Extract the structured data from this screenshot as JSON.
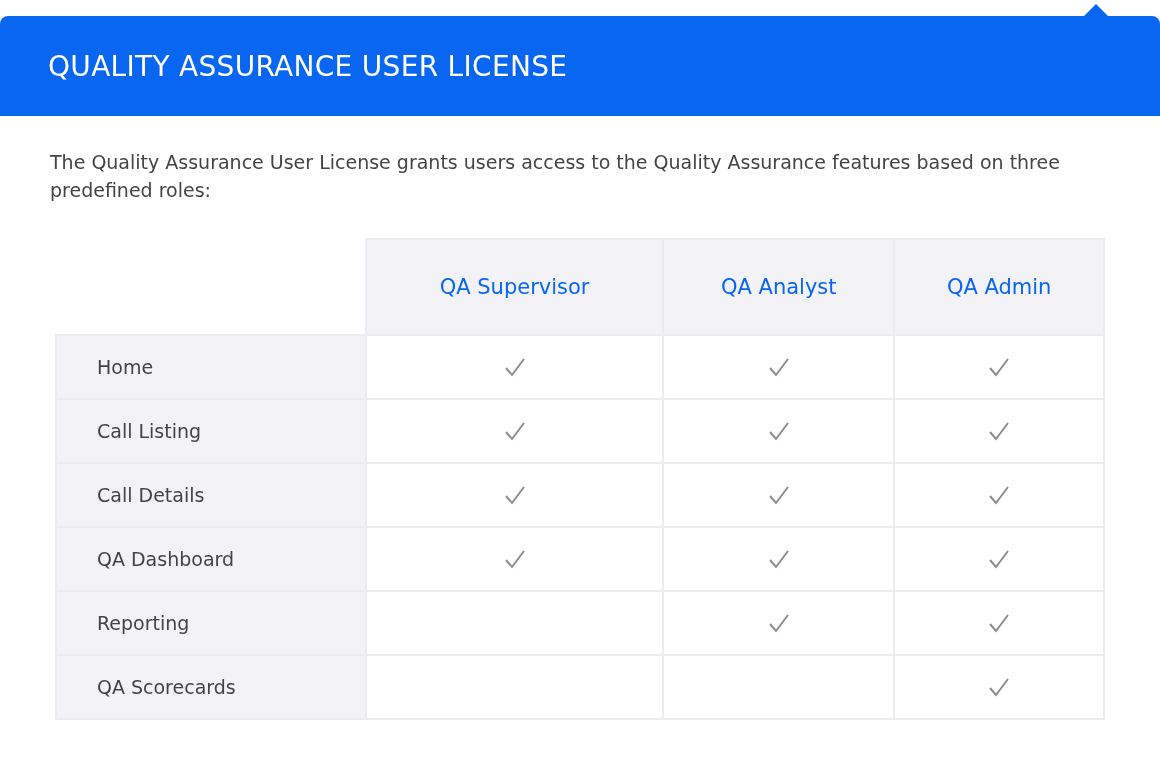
{
  "header": {
    "title": "QUALITY ASSURANCE USER LICENSE"
  },
  "description": "The Quality Assurance User License grants users access to the Quality Assurance features based on three predefined roles:",
  "table": {
    "columns": [
      "QA Supervisor",
      "QA Analyst",
      "QA Admin"
    ],
    "rows": [
      {
        "feature": "Home",
        "checked": [
          true,
          true,
          true
        ]
      },
      {
        "feature": "Call Listing",
        "checked": [
          true,
          true,
          true
        ]
      },
      {
        "feature": "Call Details",
        "checked": [
          true,
          true,
          true
        ]
      },
      {
        "feature": "QA Dashboard",
        "checked": [
          true,
          true,
          true
        ]
      },
      {
        "feature": "Reporting",
        "checked": [
          false,
          true,
          true
        ]
      },
      {
        "feature": "QA Scorecards",
        "checked": [
          false,
          false,
          true
        ]
      }
    ]
  }
}
